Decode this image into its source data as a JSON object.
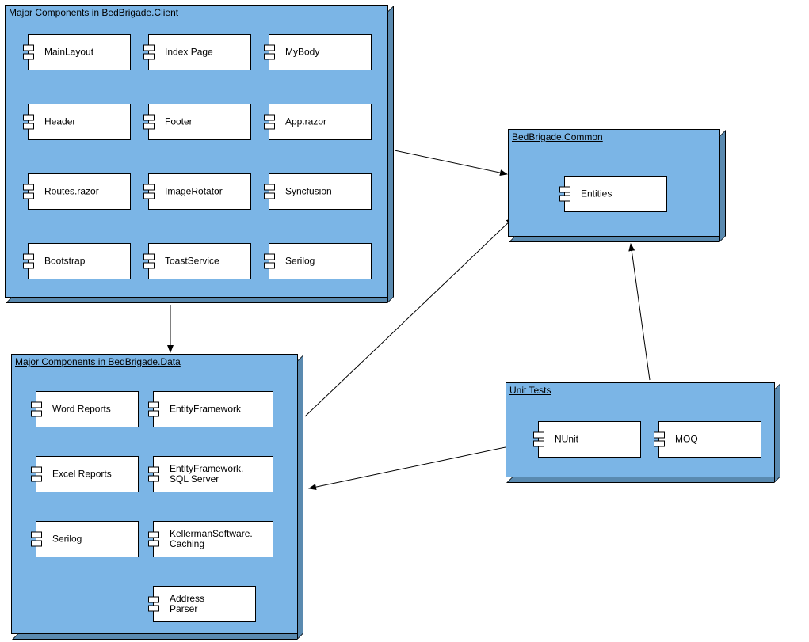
{
  "containers": {
    "client": {
      "title": "Major Components in BedBrigade.Client",
      "components": [
        "MainLayout",
        "Index Page",
        "MyBody",
        "Header",
        "Footer",
        "App.razor",
        "Routes.razor",
        "ImageRotator",
        "Syncfusion",
        "Bootstrap",
        "ToastService",
        "Serilog"
      ]
    },
    "data": {
      "title": "Major Components in BedBrigade.Data",
      "components": [
        "Word Reports",
        "EntityFramework",
        "Excel Reports",
        "EntityFramework.\nSQL Server",
        "Serilog",
        "KellermanSoftware.\nCaching",
        "Address\nParser"
      ]
    },
    "common": {
      "title": "BedBrigade.Common",
      "components": [
        "Entities"
      ]
    },
    "tests": {
      "title": "Unit Tests",
      "components": [
        "NUnit",
        "MOQ"
      ]
    }
  }
}
